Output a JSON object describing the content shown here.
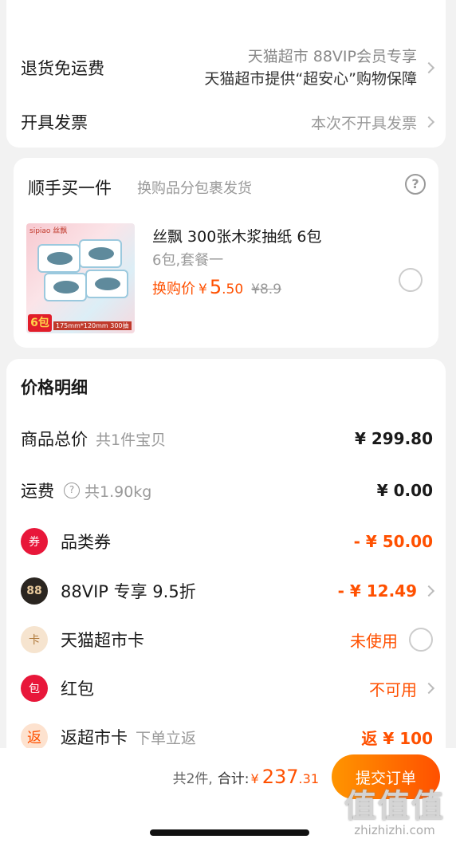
{
  "shipping": {
    "return_label": "退货免运费",
    "return_line1": "天猫超市 88VIP会员专享",
    "return_line2": "天猫超市提供“超安心”购物保障",
    "invoice_label": "开具发票",
    "invoice_value": "本次不开具发票"
  },
  "addon": {
    "title": "顺手买一件",
    "subtitle": "换购品分包裹发货",
    "help_icon": "?",
    "product": {
      "brand": "sipiao 丝飘",
      "badge": "6包",
      "spec_strip": "175mm*120mm 300抽",
      "name": "丝飘 300张木浆抽纸 6包",
      "spec": "6包,套餐一",
      "price_label": "换购价",
      "yen": "¥",
      "price_int": "5",
      "price_dec": ".50",
      "old_price": "¥8.9"
    }
  },
  "price": {
    "title": "价格明细",
    "rows": [
      {
        "label": "商品总价",
        "sub": "共1件宝贝",
        "value": "¥ 299.80"
      },
      {
        "label": "运费",
        "sub": "共1.90kg",
        "value": "¥ 0.00"
      },
      {
        "label": "品类券",
        "value": "- ¥ 50.00"
      },
      {
        "label": "88VIP 专享 9.5折",
        "value": "- ¥ 12.49"
      },
      {
        "label": "天猫超市卡",
        "value": "未使用"
      },
      {
        "label": "红包",
        "value": "不可用"
      },
      {
        "label": "返超市卡",
        "sub": "下单立返",
        "value": "返 ¥ 100"
      }
    ],
    "icons": {
      "coupon": "券",
      "vip": "88",
      "card": "卡",
      "redpack": "包",
      "rebate": "返"
    }
  },
  "bottom": {
    "count": "共2件,",
    "total_label": "合计:",
    "yen": "¥",
    "total_int": "237",
    "total_dec": ".31",
    "submit": "提交订单"
  },
  "watermark": {
    "main": "值值值",
    "sub": "zhizhizhi.com"
  },
  "colors": {
    "accent": "#ff5000",
    "accent_start": "#ff9500",
    "muted": "#999999"
  }
}
